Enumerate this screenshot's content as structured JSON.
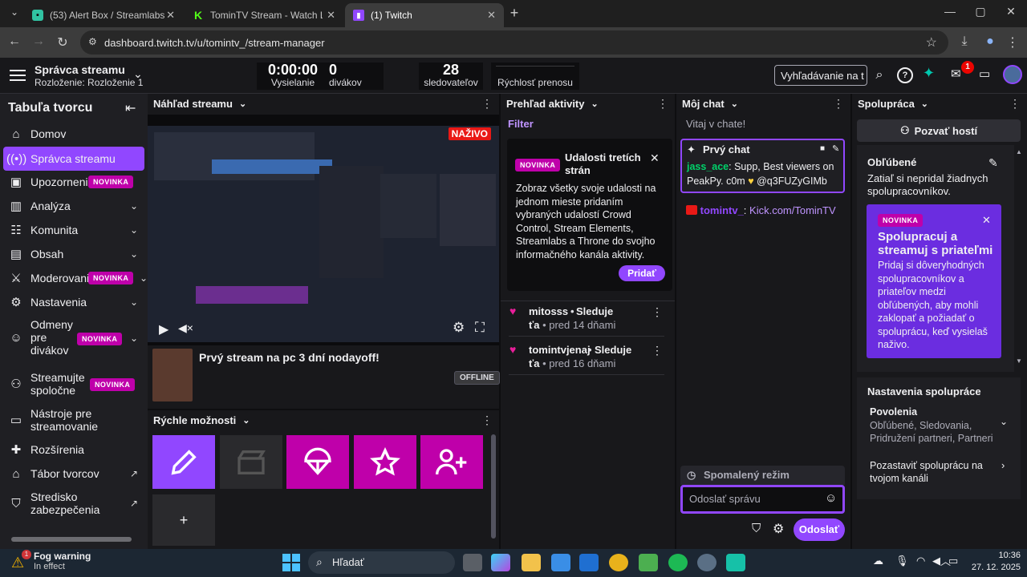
{
  "browser": {
    "tabs": [
      {
        "title": "(53) Alert Box / Streamlabs",
        "active": false
      },
      {
        "title": "TominTV Stream - Watch Live o",
        "active": false
      },
      {
        "title": "(1) Twitch",
        "active": true
      }
    ],
    "new_tab": "+",
    "url": "dashboard.twitch.tv/u/tomintv_/stream-manager",
    "window_controls": {
      "minimize": "—",
      "maximize": "▢",
      "close": "✕"
    }
  },
  "topbar": {
    "title": "Správca streamu",
    "subtitle": "Rozloženie: Rozloženie 1",
    "stats": [
      {
        "value": "0:00:00",
        "label": "Vysielanie"
      },
      {
        "value": "0",
        "label": "divákov"
      },
      {
        "value": "28",
        "label": "sledovateľov"
      },
      {
        "value": "",
        "label": "Rýchlosť prenosu"
      }
    ],
    "search_placeholder": "Vyhľadávanie na t",
    "notification_count": "1"
  },
  "sidebar": {
    "title": "Tabuľa tvorcu",
    "items": [
      {
        "label": "Domov",
        "icon": "home-icon"
      },
      {
        "label": "Správca streamu",
        "icon": "broadcast-icon",
        "active": true
      },
      {
        "label": "Upozornenia",
        "icon": "alert-icon",
        "badge": "NOVINKA"
      },
      {
        "label": "Analýza",
        "icon": "chart-icon",
        "expandable": true
      },
      {
        "label": "Komunita",
        "icon": "community-icon",
        "expandable": true
      },
      {
        "label": "Obsah",
        "icon": "content-icon",
        "expandable": true
      },
      {
        "label": "Moderovanie",
        "icon": "sword-icon",
        "badge": "NOVINKA",
        "expandable": true
      },
      {
        "label": "Nastavenia",
        "icon": "gear-icon",
        "expandable": true
      },
      {
        "label": "Odmeny pre divákov",
        "icon": "smile-icon",
        "badge": "NOVINKA",
        "expandable": true
      },
      {
        "label": "Streamujte spoločne",
        "icon": "add-user-icon",
        "badge": "NOVINKA"
      },
      {
        "label": "Nástroje pre streamovanie",
        "icon": "camera-icon"
      },
      {
        "label": "Rozšírenia",
        "icon": "puzzle-icon"
      },
      {
        "label": "Tábor tvorcov",
        "icon": "external-link-icon"
      },
      {
        "label": "Stredisko zabezpečenia",
        "icon": "shield-icon"
      }
    ]
  },
  "preview": {
    "title": "Náhľad streamu",
    "live_badge": "NAŽIVO",
    "stream_title": "Prvý stream na pc 3 dní nodayoff!",
    "status": "OFFLINE"
  },
  "quick_actions": {
    "title": "Rýchle možnosti",
    "buttons": [
      "edit-icon",
      "clapper-icon",
      "parachute-icon",
      "star-icon",
      "add-user-icon"
    ],
    "add": "+"
  },
  "activity": {
    "title": "Prehľad aktivity",
    "filter": "Filter",
    "promo": {
      "badge": "NOVINKA",
      "title": "Udalosti tretích strán",
      "body": "Zobraz všetky svoje udalosti na jednom mieste pridaním vybraných udalostí Crowd Control, Stream Elements, Streamlabs a Throne do svojho informačného kanála aktivity.",
      "button": "Pridať"
    },
    "events": [
      {
        "user": "mitosss",
        "action": "Sleduje",
        "wrap": "ťa",
        "time": "pred 14 dňami"
      },
      {
        "user": "tomintvjenaj",
        "action": "Sleduje",
        "wrap": "ťa",
        "time": "pred 16 dňami"
      }
    ]
  },
  "chat": {
    "title": "Môj chat",
    "welcome": "Vitaj v chate!",
    "pinned": {
      "label": "Prvý chat",
      "user": "jass_ace",
      "message": "Supp, Best viewers on PeakPy. c0m",
      "after": "@q3FUZyGIMb"
    },
    "messages": [
      {
        "user": "tomintv_",
        "text": "Kick.com/TominTV"
      }
    ],
    "slow_mode": "Spomalený režim",
    "input_placeholder": "Odoslať správu",
    "send": "Odoslať"
  },
  "collab": {
    "title": "Spolupráca",
    "invite": "Pozvať hostí",
    "favorites_title": "Obľúbené",
    "favorites_empty": "Zatiaľ si nepridal žiadnych spolupracovníkov.",
    "promo": {
      "badge": "NOVINKA",
      "title": "Spolupracuj a streamuj s priateľmi",
      "body": "Pridaj si dôveryhodných spolupracovníkov a priateľov medzi obľúbených, aby mohli zaklopať a požiadať o spoluprácu, keď vysielaš naživo."
    },
    "settings_title": "Nastavenia spolupráce",
    "permissions_label": "Povolenia",
    "permissions_value": "Obľúbené, Sledovania, Pridružení partneri, Partneri",
    "pause_label": "Pozastaviť spoluprácu na tvojom kanáli"
  },
  "taskbar": {
    "weather_title": "Fog warning",
    "weather_sub": "In effect",
    "weather_badge": "1",
    "search": "Hľadať",
    "time": "10:36",
    "date": "27. 12. 2025"
  },
  "colors": {
    "accent": "#9147ff",
    "magenta": "#bf00aa",
    "live": "#e91916",
    "bg": "#0e0e10",
    "panel": "#18181b"
  }
}
